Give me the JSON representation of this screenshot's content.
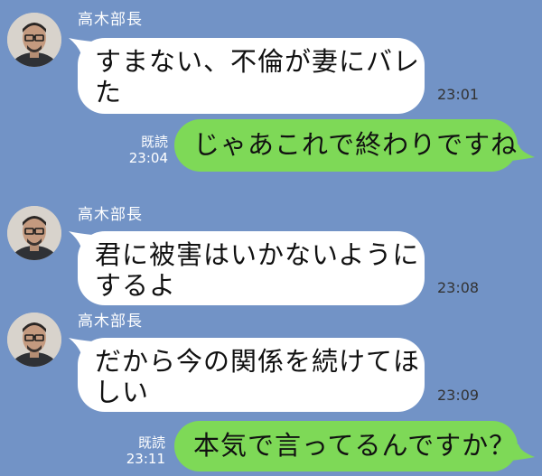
{
  "conversation": {
    "messages": [
      {
        "direction": "incoming",
        "sender": "高木部長",
        "line1": "すまない、不倫が妻にバレ",
        "line2": "た",
        "time": "23:01"
      },
      {
        "direction": "outgoing",
        "read_label": "既読",
        "text": "じゃあこれで終わりですね",
        "time": "23:04"
      },
      {
        "direction": "incoming",
        "sender": "高木部長",
        "line1": "君に被害はいかないように",
        "line2": "するよ",
        "time": "23:08"
      },
      {
        "direction": "incoming",
        "sender": "高木部長",
        "line1": "だから今の関係を続けてほ",
        "line2": "しい",
        "time": "23:09"
      },
      {
        "direction": "outgoing",
        "read_label": "既読",
        "text": "本気で言ってるんですか？",
        "time": "23:11"
      }
    ]
  },
  "colors": {
    "background": "#7293c6",
    "incoming_bubble": "#ffffff",
    "outgoing_bubble": "#7ed957"
  },
  "icons": {
    "avatar": "profile-photo",
    "tail": "speech-bubble-tail"
  }
}
